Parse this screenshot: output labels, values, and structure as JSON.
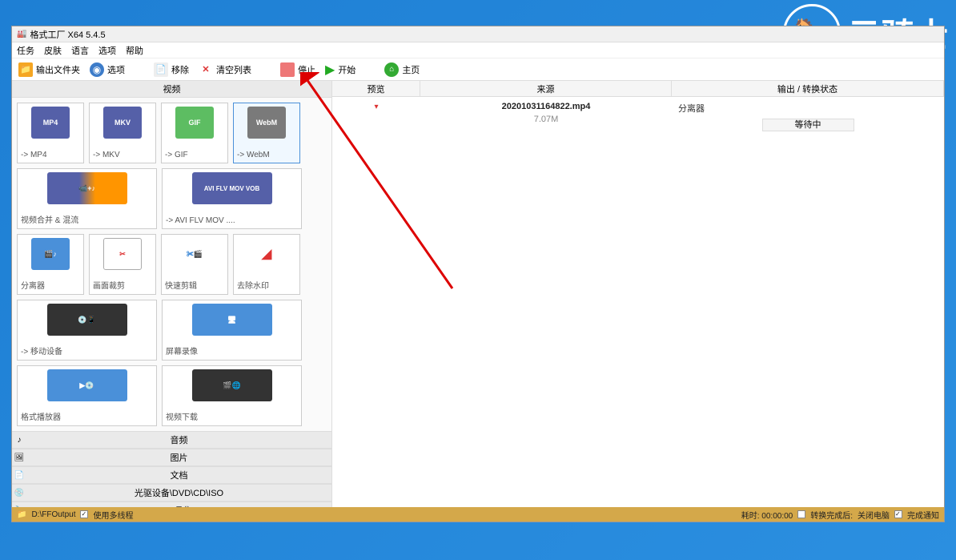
{
  "watermark": {
    "text": "云骑士"
  },
  "titlebar": {
    "title": "格式工厂 X64 5.4.5"
  },
  "menubar": {
    "items": [
      "任务",
      "皮肤",
      "语言",
      "选项",
      "帮助"
    ]
  },
  "toolbar": {
    "output_folder": "输出文件夹",
    "options": "选项",
    "remove": "移除",
    "clear_list": "清空列表",
    "stop": "停止",
    "start": "开始",
    "home": "主页"
  },
  "left_panel": {
    "main_category": "视频",
    "items": [
      {
        "label": "-> MP4"
      },
      {
        "label": "-> MKV"
      },
      {
        "label": "-> GIF"
      },
      {
        "label": "-> WebM"
      },
      {
        "label": "视频合并 & 混流"
      },
      {
        "label": "-> AVI FLV MOV ...."
      },
      {
        "label": "分离器"
      },
      {
        "label": "画面裁剪"
      },
      {
        "label": "快速剪辑"
      },
      {
        "label": "去除水印"
      },
      {
        "label": "-> 移动设备"
      },
      {
        "label": "屏幕录像"
      },
      {
        "label": "格式播放器"
      },
      {
        "label": "视频下载"
      }
    ],
    "bottom_categories": [
      "音频",
      "图片",
      "文档",
      "光驱设备\\DVD\\CD\\ISO",
      "工具集"
    ]
  },
  "right_panel": {
    "columns": {
      "preview": "预览",
      "source": "来源",
      "output": "输出 / 转换状态"
    },
    "rows": [
      {
        "filename": "20201031164822.mp4",
        "size": "7.07M",
        "separator": "分离器",
        "status": "等待中"
      }
    ]
  },
  "statusbar": {
    "output_path": "D:\\FFOutput",
    "multithread_label": "使用多线程",
    "elapsed": "耗时: 00:00:00",
    "after_done_label": "转换完成后:",
    "after_done_value": "关闭电脑",
    "notify_label": "完成通知"
  }
}
